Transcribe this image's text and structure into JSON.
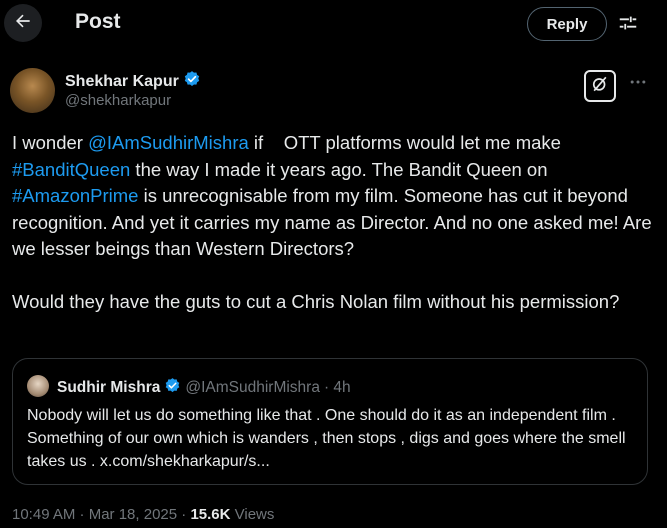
{
  "header": {
    "title": "Post",
    "reply_label": "Reply"
  },
  "tweet": {
    "author_name": "Shekhar Kapur",
    "author_handle": "@shekharkapur",
    "text": {
      "p1": {
        "s1": "I wonder ",
        "mention": "@IAmSudhirMishra",
        "s2": " if    OTT platforms would let me make ",
        "hashtag1": "#BanditQueen",
        "s3": " the way I made it years ago. The Bandit Queen on ",
        "hashtag2": "#AmazonPrime",
        "s4": " is unrecognisable from my film. Someone has cut it beyond recognition. And yet it carries my name as Director. And no one asked me! Are we lesser beings than Western Directors?"
      },
      "p2": "Would they have the guts to cut a Chris Nolan film without his permission?"
    },
    "timestamp": "10:49 AM · Mar 18, 2025 · ",
    "views_count": "15.6K",
    "views_label": " Views"
  },
  "quote": {
    "author_name": "Sudhir Mishra",
    "author_handle": "@IAmSudhirMishra",
    "time": "· 4h",
    "text": "Nobody will let us do something like that . One should do it as an independent film . Something of our own which is wanders , then stops , digs and goes where the smell takes us . x.com/shekharkapur/s..."
  },
  "icons": {
    "back": "arrow-left-icon",
    "filter": "sliders-icon",
    "verified": "verified-badge-icon",
    "grok": "grok-icon",
    "more": "more-horizontal-icon"
  },
  "colors": {
    "background": "#000000",
    "text": "#e7e9ea",
    "muted": "#71767b",
    "link": "#1d9bf0",
    "border": "#2f3336"
  }
}
